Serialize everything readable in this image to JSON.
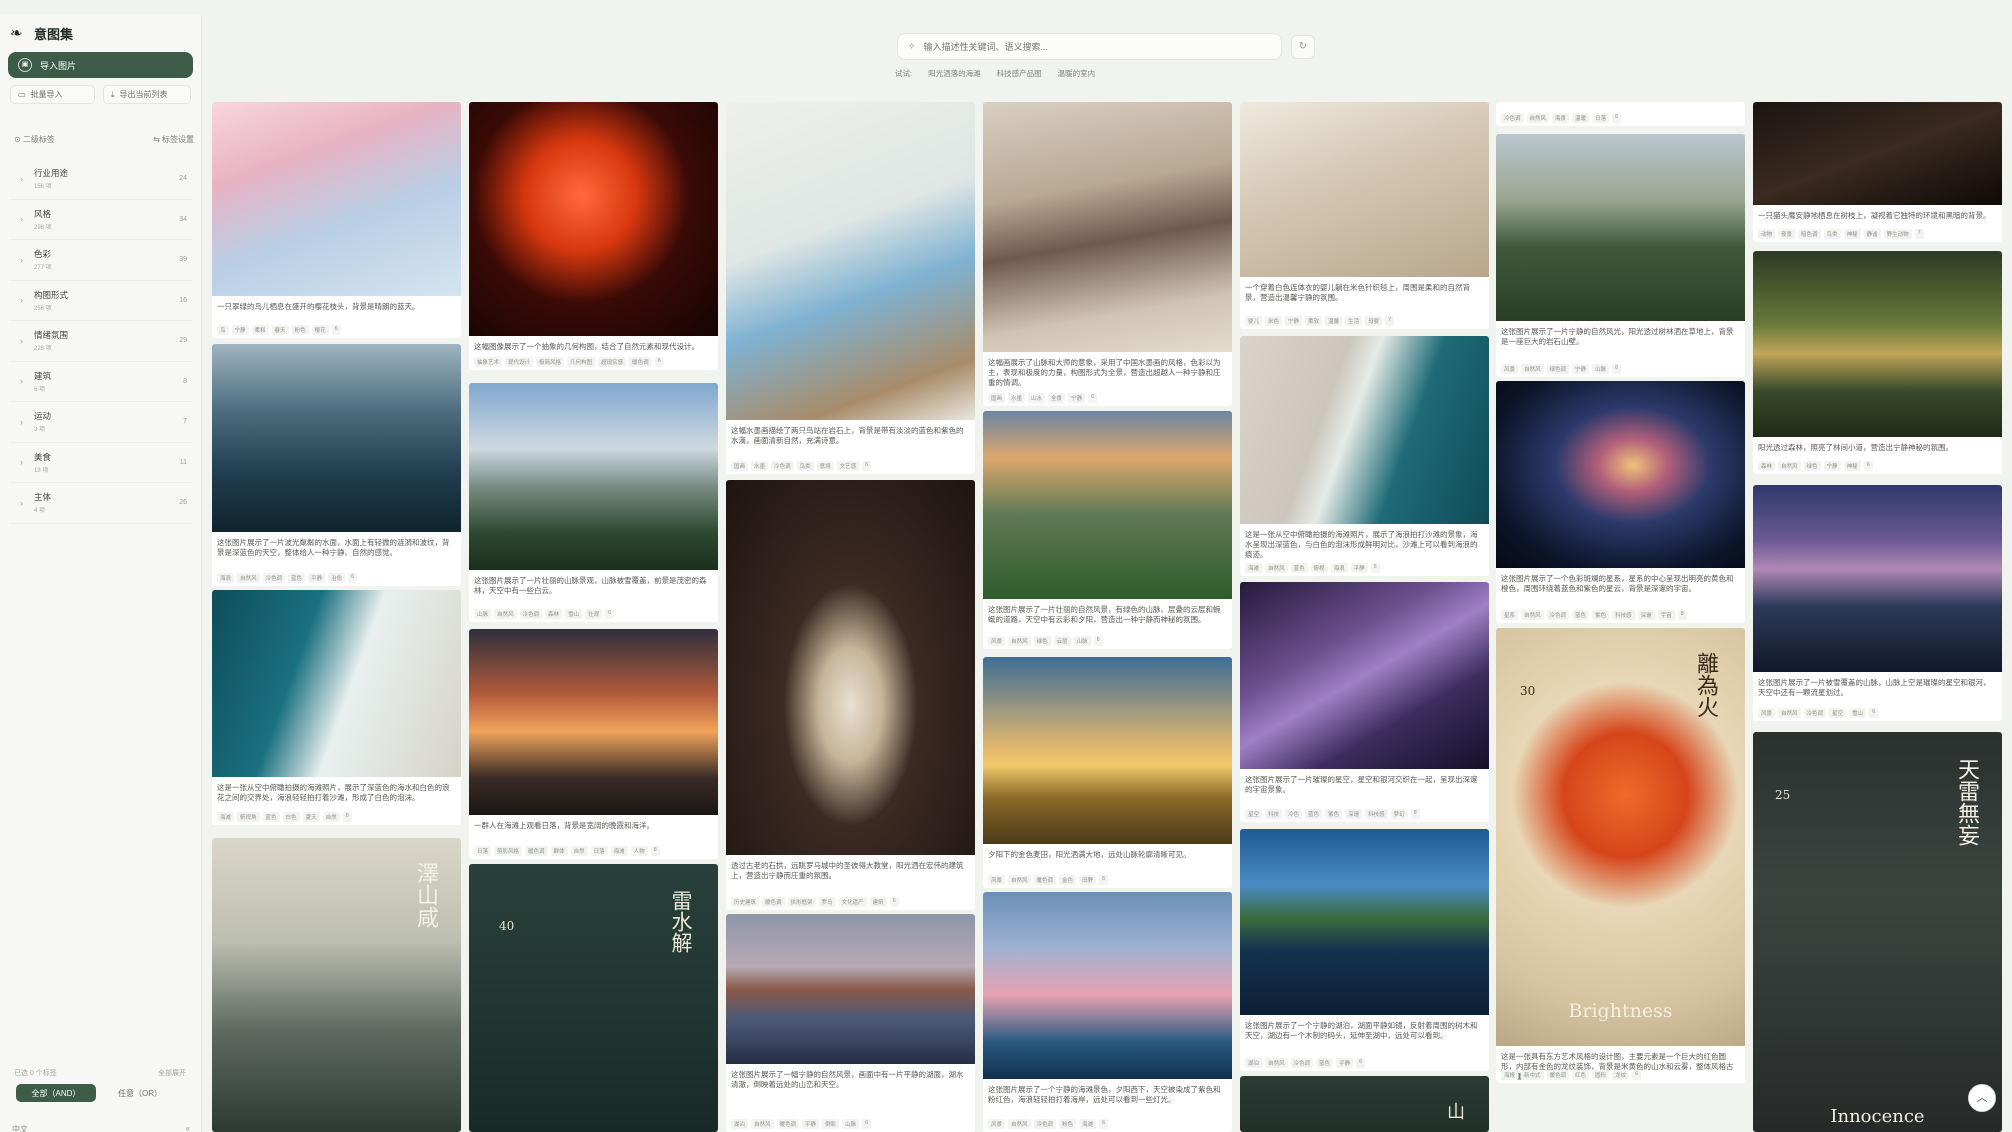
{
  "app": {
    "name": "意图集"
  },
  "sidebar": {
    "import_label": "导入图片",
    "batch_import_label": "批量导入",
    "export_list_label": "导出当前列表",
    "section_title": "二级标签",
    "section_action": "标签设置",
    "categories": [
      {
        "name": "行业用途",
        "sub": "156 项",
        "count": "24"
      },
      {
        "name": "风格",
        "sub": "298 项",
        "count": "34"
      },
      {
        "name": "色彩",
        "sub": "277 项",
        "count": "39"
      },
      {
        "name": "构图形式",
        "sub": "256 项",
        "count": "16"
      },
      {
        "name": "情绪氛围",
        "sub": "228 项",
        "count": "29"
      },
      {
        "name": "建筑",
        "sub": "6 项",
        "count": "8"
      },
      {
        "name": "运动",
        "sub": "3 项",
        "count": "7"
      },
      {
        "name": "美食",
        "sub": "13 项",
        "count": "11"
      },
      {
        "name": "主体",
        "sub": "4 项",
        "count": "26"
      }
    ],
    "footer_left": "已选 0 个标签",
    "footer_right": "全部展开",
    "mode_and": "全部（AND）",
    "mode_or": "任意（OR）",
    "language": "中文",
    "collapse": "«"
  },
  "search": {
    "placeholder": "输入描述性关键词、语义搜索...",
    "suggestions": [
      "试试:",
      "阳光洒落的海滩",
      "科技感产品图",
      "温暖的室内"
    ]
  },
  "cards": {
    "c1": {
      "caption": "一只翠绿的鸟儿栖息在盛开的樱花枝头，背景是晴朗的蓝天。",
      "tags": [
        "鸟",
        "宁静",
        "柔和",
        "春天",
        "粉色",
        "樱花",
        "6"
      ]
    },
    "c2": {
      "caption": "这张图片展示了一片波光粼粼的水面，水面上有轻微的涟漪和波纹，背景是深蓝色的天空，整体给人一种宁静、自然的感觉。",
      "tags": [
        "海浪",
        "自然风",
        "冷色调",
        "蓝色",
        "平静",
        "治愈",
        "6"
      ]
    },
    "c3": {
      "caption": "这是一张从空中俯瞰拍摄的海滩照片，展示了深蓝色的海水和白色的浪花之间的交界处，海浪轻轻拍打着沙滩，形成了白色的泡沫。",
      "tags": [
        "海滩",
        "俯视角",
        "蓝色",
        "白色",
        "夏天",
        "自然",
        "6"
      ]
    },
    "c5": {
      "caption": "这幅图像展示了一个抽象的几何构图，结合了自然元素和现代设计。",
      "tags": [
        "抽象艺术",
        "现代设计",
        "极简风格",
        "几何构图",
        "超现实感",
        "暖色调",
        "6"
      ]
    },
    "c6": {
      "caption": "这张图片展示了一片壮丽的山脉景观，山脉被雪覆盖，前景是茂密的森林，天空中有一些白云。",
      "tags": [
        "山脉",
        "自然风",
        "冷色调",
        "森林",
        "雪山",
        "壮观",
        "6"
      ]
    },
    "c7": {
      "caption": "一群人在海滩上观看日落，背景是宽阔的晚霞和海洋。",
      "tags": [
        "日落",
        "剪影风格",
        "暖色调",
        "群体",
        "自然",
        "日落",
        "海滩",
        "人物",
        "8"
      ]
    },
    "c9": {
      "caption": "这幅水墨画描绘了两只鸟站在岩石上，背景是带有淡淡的蓝色和紫色的水滴，画面清新自然，充满诗意。",
      "tags": [
        "国画",
        "水墨",
        "冷色调",
        "鸟类",
        "意境",
        "文艺感",
        "6"
      ]
    },
    "c10": {
      "caption": "透过古老的石拱，远眺罗马城中的圣彼得大教堂，阳光洒在宏伟的建筑上，营造出宁静而庄重的氛围。",
      "tags": [
        "历史建筑",
        "暖色调",
        "拱形框架",
        "罗马",
        "文化遗产",
        "建筑",
        "6"
      ]
    },
    "c11": {
      "caption": "这张图片展示了一幅宁静的自然风景，画面中有一片平静的湖面，湖水清澈，倒映着远处的山峦和天空。",
      "tags": [
        "湖泊",
        "自然风",
        "暖色调",
        "平静",
        "倒影",
        "山脉",
        "6"
      ]
    },
    "c12": {
      "caption": "这幅画展示了山脉和大师的意象，采用了中国水墨画的风格，色彩以为主，表现和极度的力量，构图形式为全景，营造出超越人一种宁静和庄重的情调。",
      "tags": [
        "国画",
        "水墨",
        "山水",
        "全景",
        "宁静",
        "6"
      ]
    },
    "c13": {
      "caption": "这张图片展示了一片壮丽的自然风景，有绿色的山脉、层叠的云层和蜿蜒的道路，天空中有云彩和夕阳，营造出一种宁静而神秘的氛围。",
      "tags": [
        "风景",
        "自然风",
        "绿色",
        "云层",
        "山脉",
        "6"
      ]
    },
    "c14": {
      "caption": "夕阳下的金色麦田，阳光洒满大地，远处山脉轮廓清晰可见。",
      "tags": [
        "风景",
        "自然风",
        "暖色调",
        "金色",
        "田野",
        "6"
      ]
    },
    "c15": {
      "caption": "这张图片展示了一个宁静的海滩景色，夕阳西下，天空被染成了紫色和粉红色，海浪轻轻拍打着海岸，远处可以看到一些灯光。",
      "tags": [
        "风景",
        "自然风",
        "冷色调",
        "粉色",
        "海滩",
        "6"
      ]
    },
    "c16": {
      "caption": "一个穿着白色连体衣的婴儿躺在米色针织毯上，周围是柔和的自然背景，营造出温馨宁静的氛围。",
      "tags": [
        "婴儿",
        "米色",
        "宁静",
        "柔软",
        "温馨",
        "生活",
        "母婴",
        "7"
      ]
    },
    "c17": {
      "caption": "这是一张从空中俯瞰拍摄的海滩照片，展示了海浪拍打沙滩的景象，海水呈现出深蓝色，与白色的泡沫形成鲜明对比，沙滩上可以看到海浪的痕迹。",
      "tags": [
        "海滩",
        "自然风",
        "蓝色",
        "俯视",
        "海浪",
        "平静",
        "6"
      ]
    },
    "c18": {
      "caption": "这张图片展示了一片璀璨的星空，星空和银河交织在一起，呈现出深邃的宇宙景象。",
      "tags": [
        "星空",
        "科技",
        "冷色",
        "蓝色",
        "紫色",
        "深邃",
        "科技感",
        "梦幻",
        "8"
      ]
    },
    "c19": {
      "caption": "这张图片展示了一个宁静的湖泊，湖面平静如镜，反射着周围的树木和天空，湖边有一个木制的码头，延伸至湖中，远处可以看到。",
      "tags": [
        "湖泊",
        "自然风",
        "冷色调",
        "蓝色",
        "平静",
        "6"
      ]
    },
    "c21": {
      "caption": "这张图片展示了一片宁静的自然风光，阳光透过树林洒在草地上，背景是一座巨大的岩石山壁。",
      "tags": [
        "风景",
        "自然风",
        "绿色调",
        "宁静",
        "山脉",
        "6"
      ]
    },
    "c22": {
      "caption": "这张图片展示了一个色彩斑斓的星系，星系的中心呈现出明亮的黄色和橙色，周围环绕着蓝色和紫色的星云，背景是深邃的宇宙。",
      "tags": [
        "星系",
        "自然风",
        "冷色调",
        "蓝色",
        "紫色",
        "科技感",
        "深邃",
        "宇宙",
        "8"
      ]
    },
    "c23": {
      "caption": "这是一张具有东方艺术风格的设计图，主要元素是一个巨大的红色圆形，内部有金色的龙纹装饰，背景是米黄色的山水和云雾，整体风格古典庄重。",
      "tags": [
        "海报",
        "新中式",
        "暖色调",
        "红色",
        "圆形",
        "龙纹",
        "6"
      ]
    },
    "c24": {
      "caption": "一只猫头鹰安静地栖息在树枝上，凝视着它独特的环境和黑暗的背景。",
      "tags": [
        "动物",
        "夜景",
        "暗色调",
        "鸟类",
        "神秘",
        "静谧",
        "野生动物",
        "7"
      ]
    },
    "c25": {
      "caption": "阳光透过森林，照亮了林间小道，营造出宁静神秘的氛围。",
      "tags": [
        "森林",
        "自然风",
        "绿色",
        "宁静",
        "神秘",
        "6"
      ]
    },
    "c26": {
      "caption": "这张图片展示了一片被雪覆盖的山脉，山脉上空是璀璨的星空和银河，天空中还有一颗流星划过。",
      "tags": [
        "风景",
        "自然风",
        "冷色调",
        "星空",
        "雪山",
        "6"
      ]
    },
    "c20top": {
      "caption": "",
      "tags": [
        "冷色调",
        "自然风",
        "海景",
        "温暖",
        "日落",
        "6"
      ]
    }
  },
  "overlays": {
    "c4_title": "澤山咸",
    "c8_title": "雷水解",
    "c8_num": "40",
    "c23_title": "離為火",
    "c23_num": "30",
    "c23_word": "Brightness",
    "c27_title": "天雷無妄",
    "c27_num": "25",
    "c27_word": "Innocence",
    "c20_char": "山"
  },
  "icons": [
    "logo-icon",
    "image-icon",
    "folder-icon",
    "download-icon",
    "tag-icon",
    "settings-icon",
    "sparkle-icon",
    "refresh-icon",
    "chevron-right-icon",
    "arrow-up-icon"
  ]
}
